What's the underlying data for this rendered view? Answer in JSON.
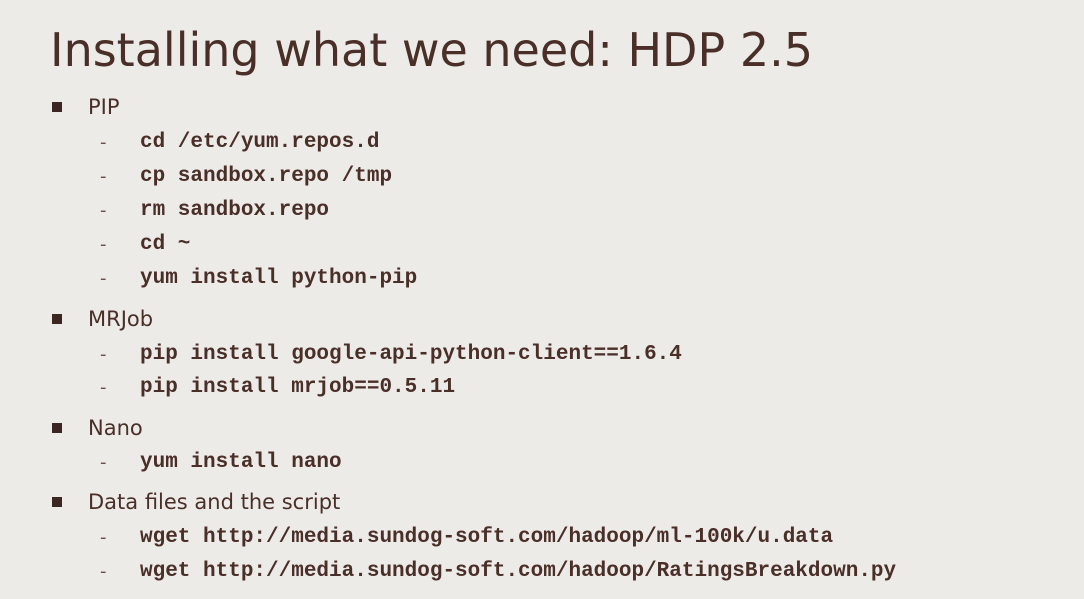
{
  "slide": {
    "title": "Installing what we need: HDP 2.5"
  },
  "sections": [
    {
      "label": "PIP",
      "commands": [
        "cd /etc/yum.repos.d",
        "cp sandbox.repo /tmp",
        "rm sandbox.repo",
        "cd ~",
        "yum install python-pip"
      ]
    },
    {
      "label": "MRJob",
      "commands": [
        "pip install google-api-python-client==1.6.4",
        "pip install mrjob==0.5.11"
      ]
    },
    {
      "label": "Nano",
      "commands": [
        "yum install nano"
      ]
    },
    {
      "label": "Data files and the script",
      "commands": [
        "wget http://media.sundog-soft.com/hadoop/ml-100k/u.data",
        "wget http://media.sundog-soft.com/hadoop/RatingsBreakdown.py"
      ]
    }
  ],
  "colors": {
    "background": "#ecebe8",
    "text": "#4a2e28",
    "bullet": "#3c2622"
  },
  "icons": {
    "section_bullet": "square-bullet-icon",
    "command_marker": "dash-marker"
  }
}
